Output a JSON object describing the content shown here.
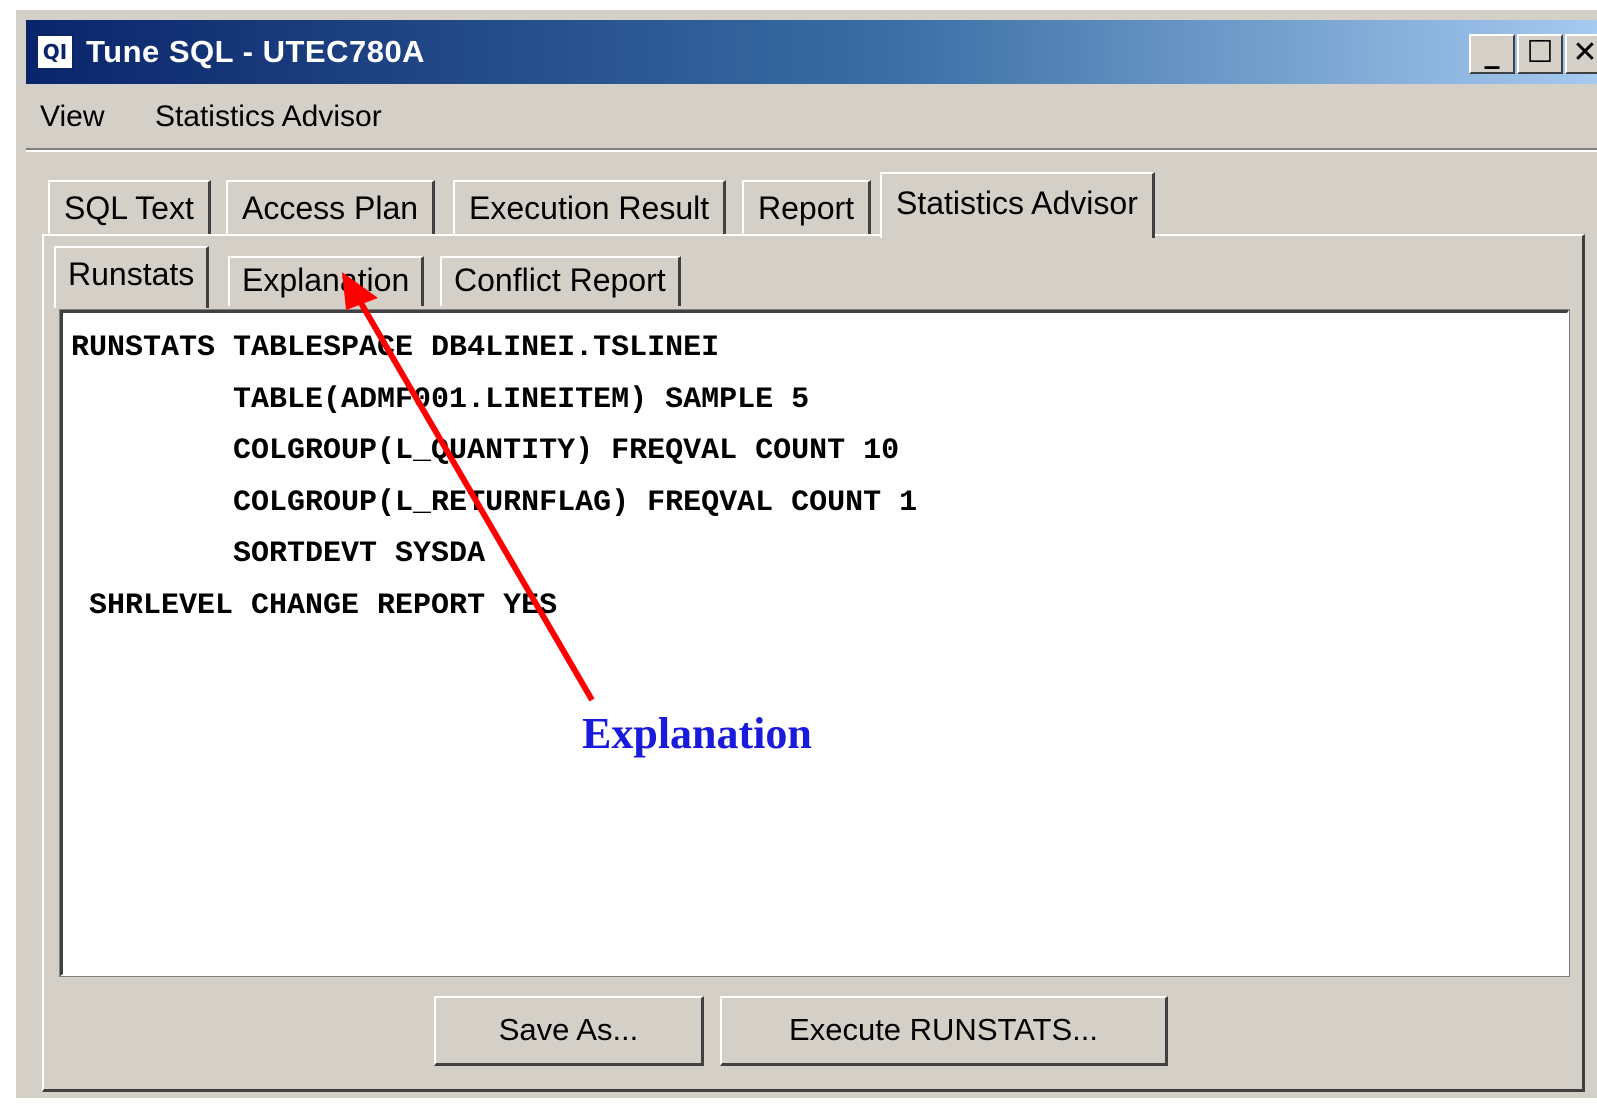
{
  "window": {
    "app_icon": "QI",
    "title": "Tune SQL - UTEC780A",
    "controls": {
      "minimize": "_",
      "maximize": "☐",
      "close": "✕"
    }
  },
  "menu": [
    "View",
    "Statistics Advisor"
  ],
  "tabs": [
    "SQL Text",
    "Access Plan",
    "Execution Result",
    "Report",
    "Statistics Advisor"
  ],
  "active_tab": "Statistics Advisor",
  "subtabs": [
    "Runstats",
    "Explanation",
    "Conflict Report"
  ],
  "active_subtab": "Runstats",
  "runstats_text": "RUNSTATS TABLESPACE DB4LINEI.TSLINEI\n         TABLE(ADMF001.LINEITEM) SAMPLE 5\n         COLGROUP(L_QUANTITY) FREQVAL COUNT 10\n         COLGROUP(L_RETURNFLAG) FREQVAL COUNT 1\n         SORTDEVT SYSDA\n SHRLEVEL CHANGE REPORT YES",
  "buttons": {
    "save_as": "Save As...",
    "execute": "Execute RUNSTATS..."
  },
  "callout": {
    "label": "Explanation",
    "label_color": "#1a1adc",
    "arrow_color": "#ff0000"
  },
  "colors": {
    "title_bar_start": "#0a246a",
    "title_bar_end": "#a6caf0",
    "face": "#d4d0c8"
  }
}
